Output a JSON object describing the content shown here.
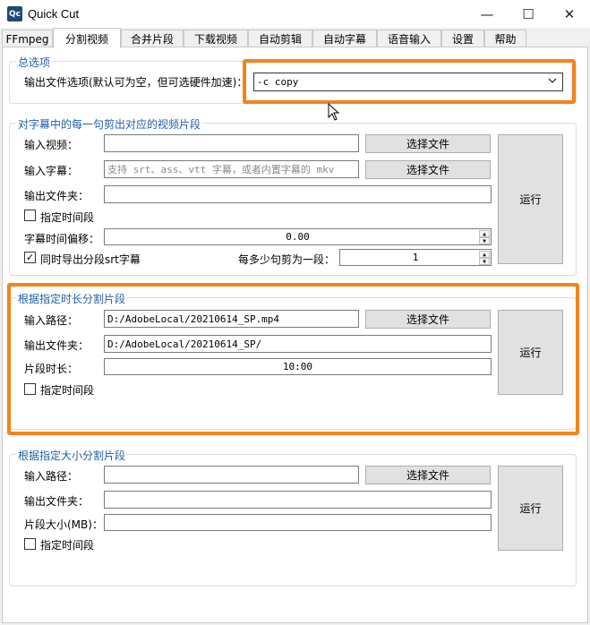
{
  "window": {
    "icon_text": "Qc",
    "title": "Quick Cut",
    "minimize": "—",
    "maximize": "☐",
    "close": "✕"
  },
  "tabs": [
    "FFmpeg",
    "分割视频",
    "合并片段",
    "下载视频",
    "自动剪辑",
    "自动字幕",
    "语音输入",
    "设置",
    "帮助"
  ],
  "general": {
    "title": "总选项",
    "output_label": "输出文件选项(默认可为空，但可选硬件加速)：",
    "output_value": "-c copy",
    "dropdown_arrow": "chevron-down-icon"
  },
  "subtitle_group": {
    "title": "对字幕中的每一句剪出对应的视频片段",
    "input_video_label": "输入视频：",
    "input_video_value": "",
    "input_subtitle_label": "输入字幕：",
    "input_subtitle_placeholder": "支持 srt、ass、vtt 字幕，或者内置字幕的 mkv",
    "output_folder_label": "输出文件夹：",
    "output_folder_value": "",
    "choose_file": "选择文件",
    "choose_file2": "选择文件",
    "run": "运行",
    "time_range_label": "指定时间段",
    "offset_label": "字幕时间偏移：",
    "offset_value": "0.00",
    "export_srt_label": "同时导出分段srt字幕",
    "export_srt_checked": "✓",
    "per_segment_label": "每多少句剪为一段：",
    "per_segment_value": "1"
  },
  "duration_group": {
    "title": "根据指定时长分割片段",
    "input_path_label": "输入路径：",
    "input_path_value": "D:/AdobeLocal/20210614_SP.mp4",
    "output_folder_label": "输出文件夹：",
    "output_folder_value": "D:/AdobeLocal/20210614_SP/",
    "segment_length_label": "片段时长：",
    "segment_length_value": "10:00",
    "choose_file": "选择文件",
    "run": "运行",
    "time_range_label": "指定时间段"
  },
  "size_group": {
    "title": "根据指定大小分割片段",
    "input_path_label": "输入路径：",
    "input_path_value": "",
    "output_folder_label": "输出文件夹：",
    "output_folder_value": "",
    "segment_size_label": "片段大小(MB)：",
    "segment_size_value": "",
    "choose_file": "选择文件",
    "run": "运行",
    "time_range_label": "指定时间段"
  },
  "colors": {
    "highlight": "#f58220",
    "group_title": "#1f5fa8"
  }
}
